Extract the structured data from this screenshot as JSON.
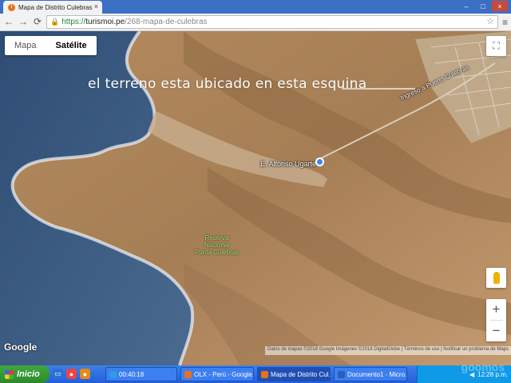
{
  "browser": {
    "tab_title": "Mapa de Distrito Culebras",
    "tab_close": "×",
    "window_min": "–",
    "window_max": "□",
    "window_close": "×",
    "back_icon": "←",
    "forward_icon": "→",
    "reload_icon": "⟳",
    "url_scheme": "https://",
    "url_host": "turismoi.pe",
    "url_path": "/268-mapa-de-culebras",
    "star_icon": "☆",
    "menu_icon": "≡"
  },
  "map": {
    "type_options": [
      "Mapa",
      "Satélite"
    ],
    "selected_type": "Satélite",
    "fullscreen_icon": "⛶",
    "annotation": "el terreno esta ubicado en esta esquina",
    "road_label": "Ingreso a Puerto Culebras",
    "place_label": "E. Alfonso Ugarte",
    "reserve_label": [
      "Reserva",
      "Nacional",
      "Punta Culebras"
    ],
    "zoom_in": "+",
    "zoom_out": "−",
    "google_logo": "Google",
    "attribution": "Datos de mapas ©2018 Google Imágenes ©2018 DigitalGlobe | Términos de uso | Notificar un problema de Maps"
  },
  "taskbar": {
    "start_label": "Inicio",
    "tasks": [
      {
        "label": "00:40:18",
        "color": "#2e9be8"
      },
      {
        "label": "OLX - Perú - Google...",
        "color": "#e8711c"
      },
      {
        "label": "Mapa de Distrito Cul...",
        "color": "#e8711c"
      },
      {
        "label": "Documento1 - Micro...",
        "color": "#2b5fb8"
      }
    ],
    "clock": "12:28 p.m.",
    "watermark": "goomos"
  },
  "colors": {
    "ocean": "#3d5a80",
    "desert": "#a8865c",
    "titlebar": "#3a6fc4"
  }
}
